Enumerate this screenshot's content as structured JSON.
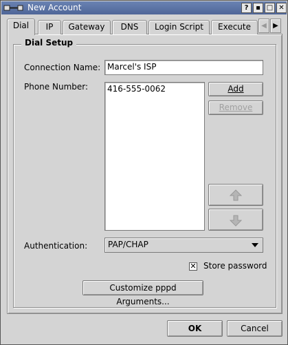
{
  "window": {
    "title": "New Account"
  },
  "titlebar_buttons": {
    "help": "?",
    "minimize": "▪",
    "maximize": "□",
    "close": "✕"
  },
  "tabs": [
    {
      "label": "Dial",
      "active": true
    },
    {
      "label": "IP"
    },
    {
      "label": "Gateway"
    },
    {
      "label": "DNS"
    },
    {
      "label": "Login Script"
    },
    {
      "label": "Execute"
    }
  ],
  "tab_nav": {
    "left": "◀",
    "right": "▶"
  },
  "dial_setup": {
    "group_title": "Dial Setup",
    "connection_name_label": "Connection Name:",
    "connection_name_value": "Marcel's ISP",
    "phone_number_label": "Phone Number:",
    "phone_numbers": [
      "416-555-0062"
    ],
    "add_button": "Add",
    "remove_button": "Remove",
    "up_icon": "arrow-up-icon",
    "down_icon": "arrow-down-icon",
    "authentication_label": "Authentication:",
    "authentication_value": "PAP/CHAP",
    "store_password_checked": true,
    "store_password_label": "Store password",
    "customize_button": "Customize pppd Arguments..."
  },
  "footer": {
    "ok_button": "OK",
    "cancel_button": "Cancel"
  }
}
